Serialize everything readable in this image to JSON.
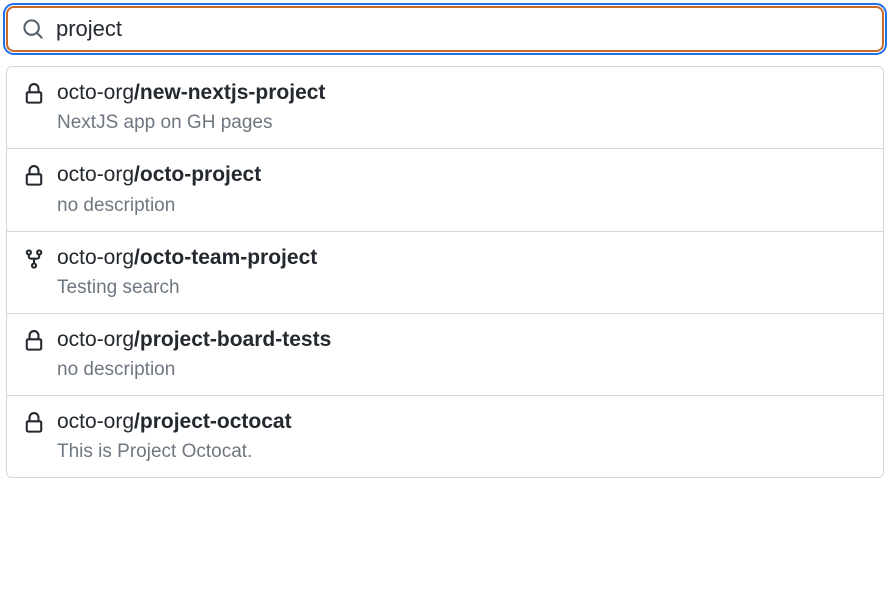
{
  "search": {
    "value": "project",
    "placeholder": ""
  },
  "results": [
    {
      "icon": "lock",
      "org": "octo-org",
      "name": "new-nextjs-project",
      "description": "NextJS app on GH pages"
    },
    {
      "icon": "lock",
      "org": "octo-org",
      "name": "octo-project",
      "description": "no description"
    },
    {
      "icon": "fork",
      "org": "octo-org",
      "name": "octo-team-project",
      "description": "Testing search"
    },
    {
      "icon": "lock",
      "org": "octo-org",
      "name": "project-board-tests",
      "description": "no description"
    },
    {
      "icon": "lock",
      "org": "octo-org",
      "name": "project-octocat",
      "description": "This is Project Octocat."
    }
  ]
}
